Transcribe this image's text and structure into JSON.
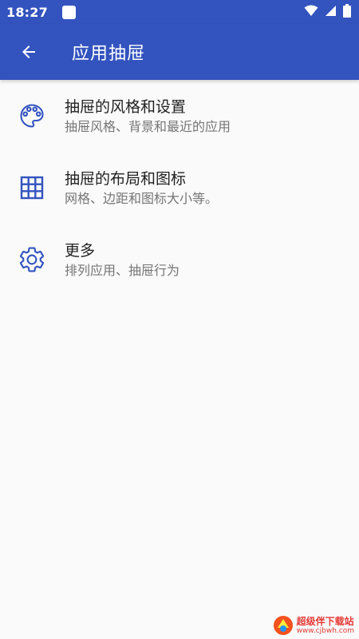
{
  "status_bar": {
    "time": "18:27",
    "icons": [
      "notification-icon",
      "wifi-icon",
      "signal-icon",
      "battery-icon"
    ]
  },
  "app_bar": {
    "back_icon": "arrow-back-icon",
    "title": "应用抽屉"
  },
  "list": {
    "items": [
      {
        "icon": "palette-icon",
        "title": "抽屉的风格和设置",
        "subtitle": "抽屉风格、背景和最近的应用"
      },
      {
        "icon": "grid-icon",
        "title": "抽屉的布局和图标",
        "subtitle": "网格、边距和图标大小等。"
      },
      {
        "icon": "gear-icon",
        "title": "更多",
        "subtitle": "排列应用、抽屉行为"
      }
    ]
  },
  "watermark": {
    "name": "超级伴下载站",
    "url": "www.cjbwh.com"
  },
  "colors": {
    "primary": "#3353bf",
    "icon_accent": "#3353bf",
    "background": "#fafafa",
    "title_text": "#222222",
    "subtitle_text": "#757575"
  }
}
